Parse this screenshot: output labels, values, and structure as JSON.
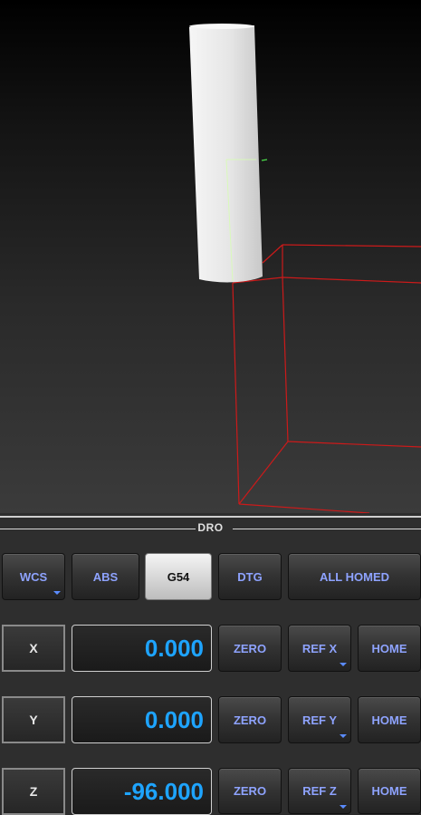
{
  "dro": {
    "title": "DRO",
    "top_buttons": {
      "wcs": "WCS",
      "abs": "ABS",
      "g54": "G54",
      "dtg": "DTG",
      "all_homed": "ALL HOMED"
    },
    "axes": [
      {
        "label": "X",
        "value": "0.000",
        "zero": "ZERO",
        "ref": "REF X",
        "home": "HOME"
      },
      {
        "label": "Y",
        "value": "0.000",
        "zero": "ZERO",
        "ref": "REF Y",
        "home": "HOME"
      },
      {
        "label": "Z",
        "value": "-96.000",
        "zero": "ZERO",
        "ref": "REF Z",
        "home": "HOME"
      }
    ]
  },
  "colors": {
    "accent_text": "#8ea3ff",
    "value_text": "#1ea4ff",
    "boundary_box": "#cc1a1a",
    "tool": "#e8e8e8"
  }
}
